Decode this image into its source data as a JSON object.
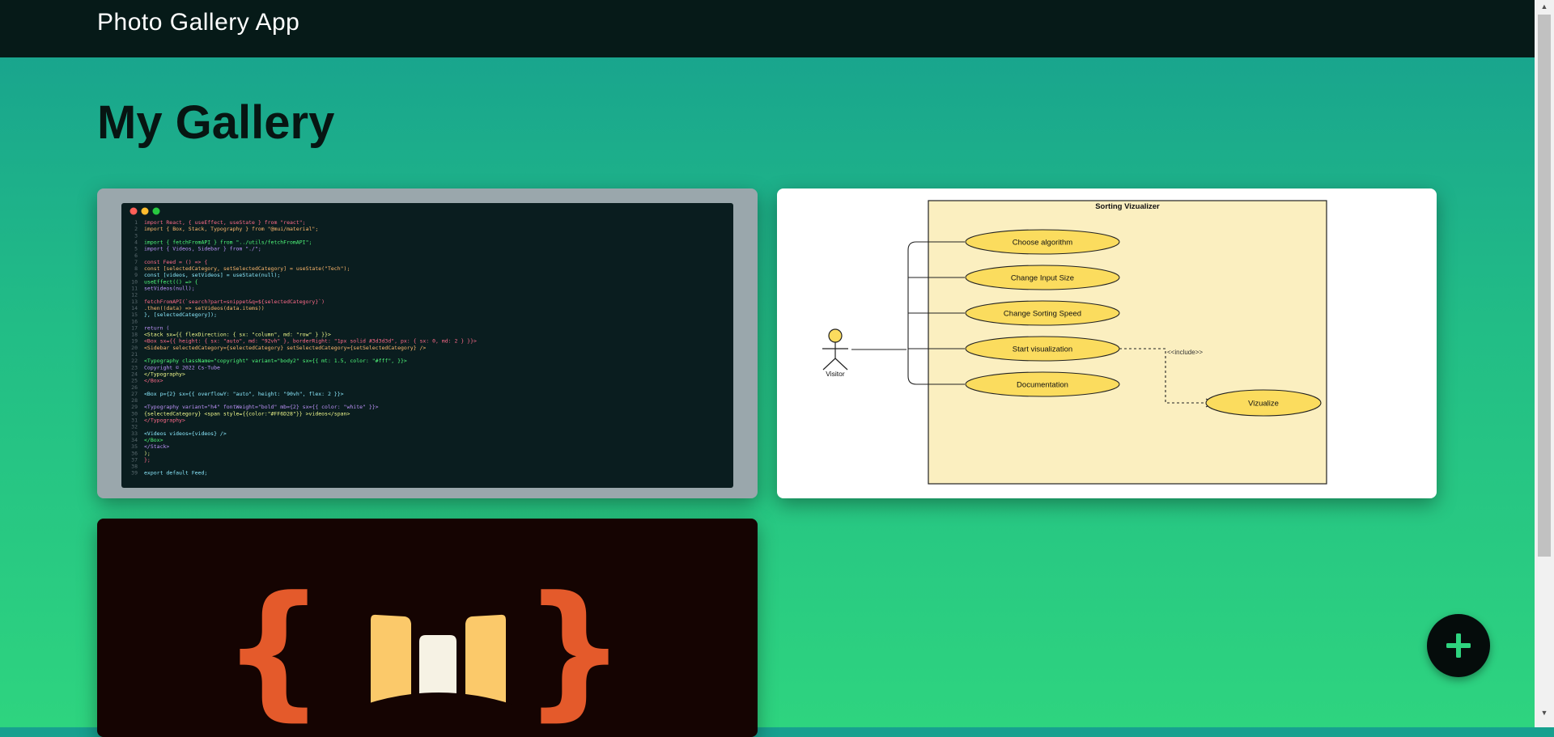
{
  "header": {
    "app_title": "Photo Gallery App"
  },
  "main": {
    "page_title": "My Gallery"
  },
  "gallery": {
    "code_card": {
      "lines": [
        {
          "n": "1",
          "t": "import React, { useEffect, useState } from \"react\";"
        },
        {
          "n": "2",
          "t": "import { Box, Stack, Typography } from \"@mui/material\";"
        },
        {
          "n": "3",
          "t": ""
        },
        {
          "n": "4",
          "t": "import { fetchFromAPI } from \"../utils/fetchFromAPI\";"
        },
        {
          "n": "5",
          "t": "import { Videos, Sidebar } from \"./\";"
        },
        {
          "n": "6",
          "t": ""
        },
        {
          "n": "7",
          "t": "const Feed = () => {"
        },
        {
          "n": "8",
          "t": "  const [selectedCategory, setSelectedCategory] = useState(\"Tech\");"
        },
        {
          "n": "9",
          "t": "  const [videos, setVideos] = useState(null);"
        },
        {
          "n": "10",
          "t": "  useEffect(() => {"
        },
        {
          "n": "11",
          "t": "    setVideos(null);"
        },
        {
          "n": "12",
          "t": ""
        },
        {
          "n": "13",
          "t": "    fetchFromAPI(`search?part=snippet&q=${selectedCategory}`)"
        },
        {
          "n": "14",
          "t": "      .then((data) => setVideos(data.items))"
        },
        {
          "n": "15",
          "t": "    }, [selectedCategory]);"
        },
        {
          "n": "16",
          "t": ""
        },
        {
          "n": "17",
          "t": "  return ("
        },
        {
          "n": "18",
          "t": "    <Stack sx={{ flexDirection: { sx: \"column\", md: \"row\" } }}>"
        },
        {
          "n": "19",
          "t": "      <Box sx={{ height: { sx: \"auto\", md: \"92vh\" }, borderRight: \"1px solid #3d3d3d\", px: { sx: 0, md: 2 } }}>"
        },
        {
          "n": "20",
          "t": "        <Sidebar selectedCategory={selectedCategory} setSelectedCategory={setSelectedCategory} />"
        },
        {
          "n": "21",
          "t": ""
        },
        {
          "n": "22",
          "t": "        <Typography className=\"copyright\" variant=\"body2\" sx={{ mt: 1.5, color: \"#fff\", }}>"
        },
        {
          "n": "23",
          "t": "          Copyright © 2022 Cs-Tube"
        },
        {
          "n": "24",
          "t": "        </Typography>"
        },
        {
          "n": "25",
          "t": "      </Box>"
        },
        {
          "n": "26",
          "t": ""
        },
        {
          "n": "27",
          "t": "      <Box p={2} sx={{ overflowY: \"auto\", height: \"90vh\", flex: 2 }}>"
        },
        {
          "n": "28",
          "t": ""
        },
        {
          "n": "29",
          "t": "      <Typography variant=\"h4\" fontWeight=\"bold\" mb={2} sx={{ color: \"white\" }}>"
        },
        {
          "n": "30",
          "t": "          {selectedCategory} <span style={{color:\"#FF6D28\"}} >videos</span>"
        },
        {
          "n": "31",
          "t": "        </Typography>"
        },
        {
          "n": "32",
          "t": ""
        },
        {
          "n": "33",
          "t": "        <Videos videos={videos} />"
        },
        {
          "n": "34",
          "t": "      </Box>"
        },
        {
          "n": "35",
          "t": "    </Stack>"
        },
        {
          "n": "36",
          "t": "  );"
        },
        {
          "n": "37",
          "t": "};"
        },
        {
          "n": "38",
          "t": ""
        },
        {
          "n": "39",
          "t": "export default Feed;"
        }
      ]
    },
    "diagram_card": {
      "title": "Sorting Vizualizer",
      "actor": "Visitor",
      "use_cases": [
        "Choose algorithm",
        "Change Input Size",
        "Change Sorting Speed",
        "Start visualization",
        "Documentation"
      ],
      "include_label": "<<include>>",
      "extra_use_case": "Vizualize"
    },
    "logo_card": {
      "left_brace": "{",
      "right_brace": "}"
    }
  },
  "fab": {
    "icon": "plus-icon"
  },
  "colors": {
    "topbar": "#061a18",
    "code_bg": "#0a1d1f",
    "diagram_box": "#fbefc0",
    "use_case_fill": "#fbdc5e",
    "brace_orange": "#e45a2b",
    "book_yellow": "#fbc96a",
    "book_white": "#f6f2e4",
    "fab_plus": "#2ed47f"
  }
}
